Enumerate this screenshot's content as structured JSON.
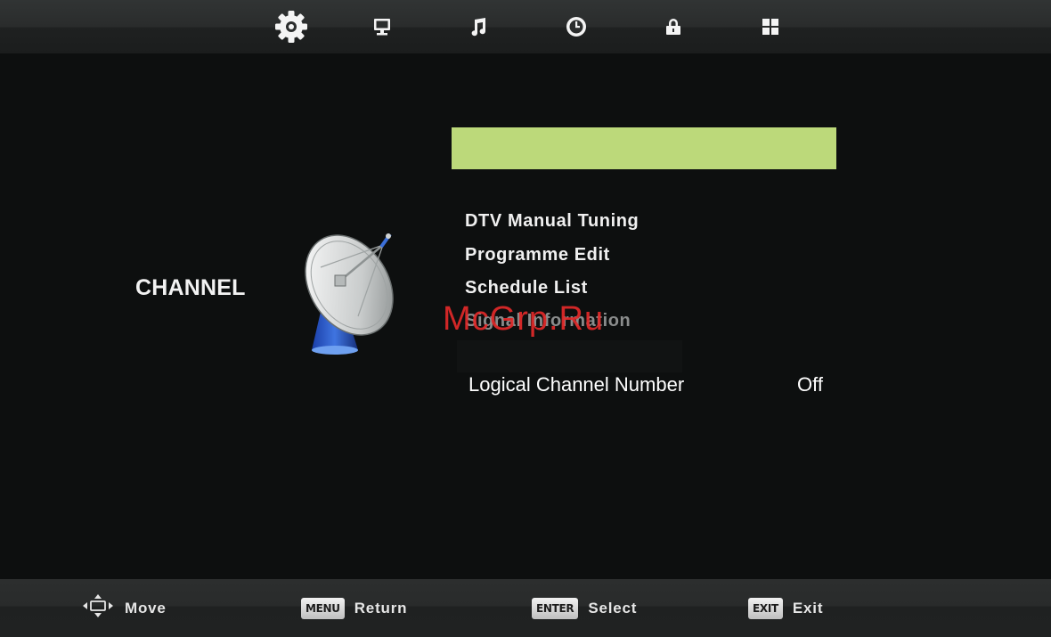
{
  "top_tabs": [
    {
      "icon": "gear-icon",
      "active": true
    },
    {
      "icon": "monitor-icon",
      "active": false
    },
    {
      "icon": "music-note-icon",
      "active": false
    },
    {
      "icon": "clock-icon",
      "active": false
    },
    {
      "icon": "lock-icon",
      "active": false
    },
    {
      "icon": "grid-icon",
      "active": false
    }
  ],
  "category": {
    "label": "CHANNEL",
    "icon": "satellite-dish-icon"
  },
  "menu": {
    "items": [
      {
        "label": "DTV Manual Tuning",
        "enabled": true
      },
      {
        "label": "Programme Edit",
        "enabled": true
      },
      {
        "label": "Schedule List",
        "enabled": true
      },
      {
        "label": "Signal Information",
        "enabled": false
      }
    ],
    "lcn": {
      "label": "Logical Channel Number",
      "value": "Off"
    }
  },
  "watermark": "McGrp.Ru",
  "hints": [
    {
      "key": "",
      "icon": "dpad-arrows-icon",
      "label": "Move"
    },
    {
      "key": "MENU",
      "label": "Return"
    },
    {
      "key": "ENTER",
      "label": "Select"
    },
    {
      "key": "EXIT",
      "label": "Exit"
    }
  ],
  "colors": {
    "highlight": "#bcd97a",
    "background": "#0d0f0f",
    "text": "#f0f0f0",
    "disabled_text": "#8a8c8c",
    "watermark": "#e22a2a"
  }
}
